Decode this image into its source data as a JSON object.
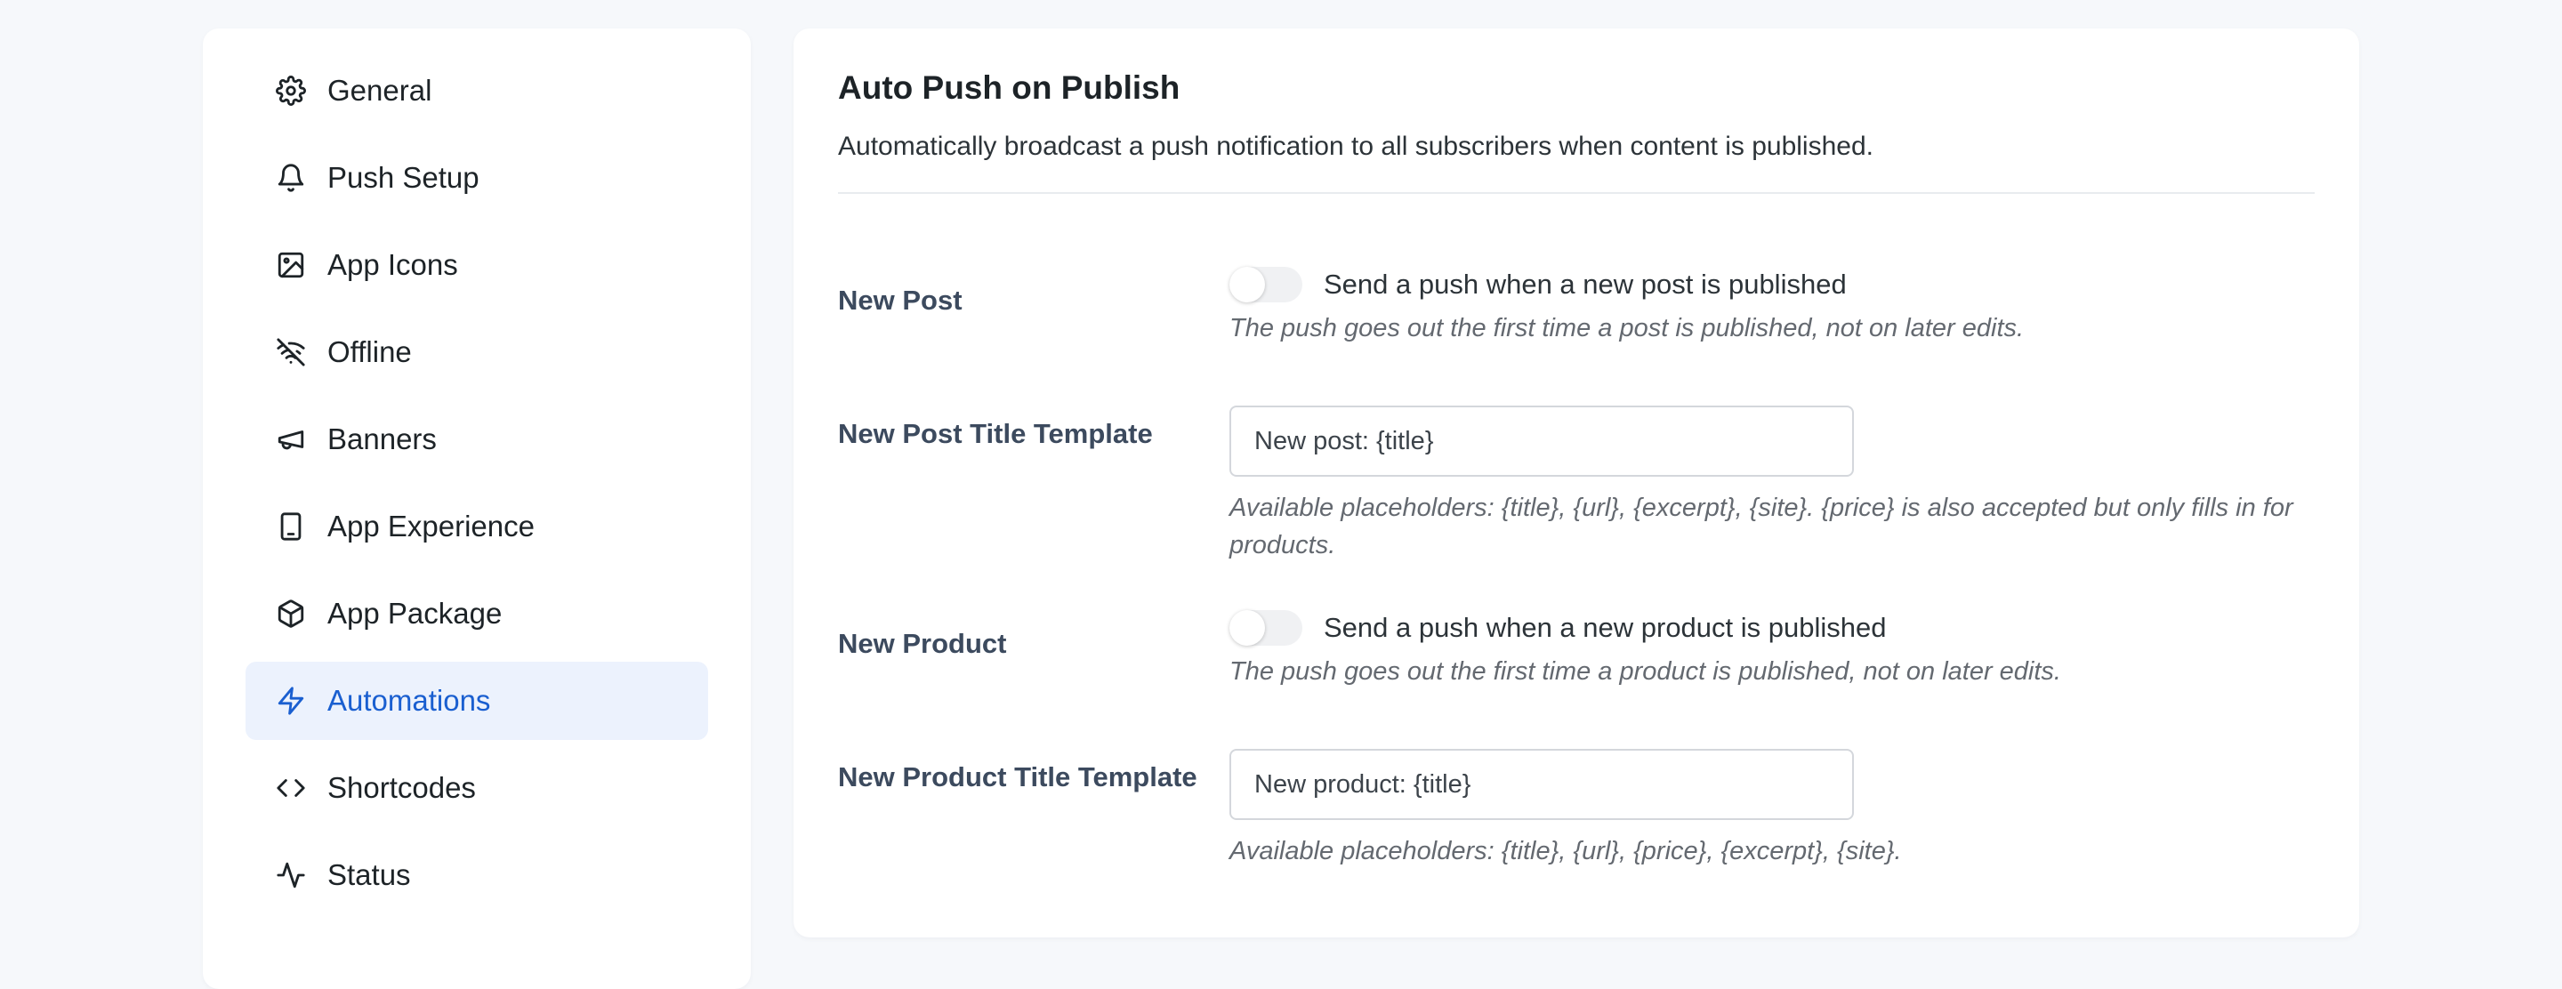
{
  "sidebar": {
    "items": [
      {
        "label": "General",
        "icon": "gear-icon"
      },
      {
        "label": "Push Setup",
        "icon": "bell-icon"
      },
      {
        "label": "App Icons",
        "icon": "image-icon"
      },
      {
        "label": "Offline",
        "icon": "wifi-off-icon"
      },
      {
        "label": "Banners",
        "icon": "megaphone-icon"
      },
      {
        "label": "App Experience",
        "icon": "phone-icon"
      },
      {
        "label": "App Package",
        "icon": "package-icon"
      },
      {
        "label": "Automations",
        "icon": "zap-icon",
        "active": true
      },
      {
        "label": "Shortcodes",
        "icon": "code-icon"
      },
      {
        "label": "Status",
        "icon": "activity-icon"
      }
    ]
  },
  "panel": {
    "title": "Auto Push on Publish",
    "description": "Automatically broadcast a push notification to all subscribers when content is published.",
    "new_post": {
      "label": "New Post",
      "toggle_text": "Send a push when a new post is published",
      "help": "The push goes out the first time a post is published, not on later edits."
    },
    "new_post_template": {
      "label": "New Post Title Template",
      "value": "New post: {title}",
      "help": "Available placeholders: {title}, {url}, {excerpt}, {site}. {price} is also accepted but only fills in for products."
    },
    "new_product": {
      "label": "New Product",
      "toggle_text": "Send a push when a new product is published",
      "help": "The push goes out the first time a product is published, not on later edits."
    },
    "new_product_template": {
      "label": "New Product Title Template",
      "value": "New product: {title}",
      "help": "Available placeholders: {title}, {url}, {price}, {excerpt}, {site}."
    }
  },
  "colors": {
    "accent": "#1a5fd0",
    "active_bg": "#ecf2fd",
    "page_bg": "#f6f8fb"
  }
}
